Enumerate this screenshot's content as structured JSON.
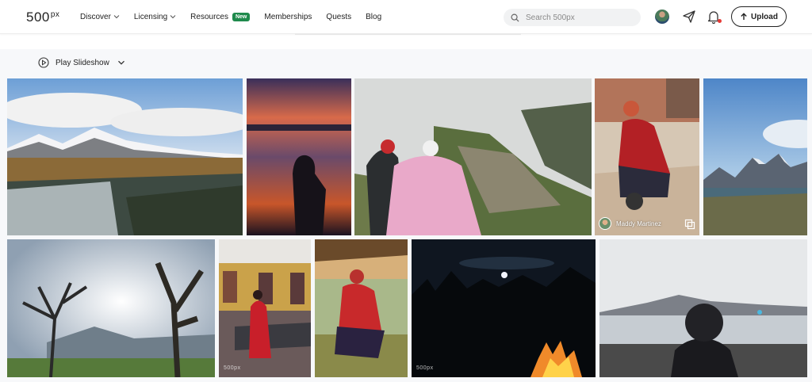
{
  "header": {
    "logo": "500",
    "logo_sup": "px",
    "nav": [
      {
        "label": "Discover",
        "dropdown": true
      },
      {
        "label": "Licensing",
        "dropdown": true
      },
      {
        "label": "Resources",
        "badge": "New"
      },
      {
        "label": "Memberships"
      },
      {
        "label": "Quests"
      },
      {
        "label": "Blog"
      }
    ],
    "search_placeholder": "Search 500px",
    "upload_label": "Upload",
    "icons": [
      "search-icon",
      "avatar",
      "send-icon",
      "bell-icon",
      "upload-arrow-icon"
    ],
    "notification_color": "#e53935",
    "badge_color": "#1f8a4c"
  },
  "slideshow": {
    "label": "Play Slideshow",
    "icons": [
      "play-circle-icon",
      "chevron-down-icon"
    ]
  },
  "gallery": {
    "photos": [
      {
        "subject": "snowy mountains and waterfall"
      },
      {
        "subject": "silhouette at sunset lake"
      },
      {
        "subject": "tourists at Machu Picchu"
      },
      {
        "subject": "woman in red weaving",
        "author": "Maddy Martinez"
      },
      {
        "subject": "Torres del Paine peaks"
      },
      {
        "subject": "bare tree and mountains"
      },
      {
        "subject": "woman in red dress at market"
      },
      {
        "subject": "woman spinning yarn"
      },
      {
        "subject": "night campfire under moon"
      },
      {
        "subject": "person in beanie by lake"
      }
    ],
    "watermark": "500px"
  }
}
